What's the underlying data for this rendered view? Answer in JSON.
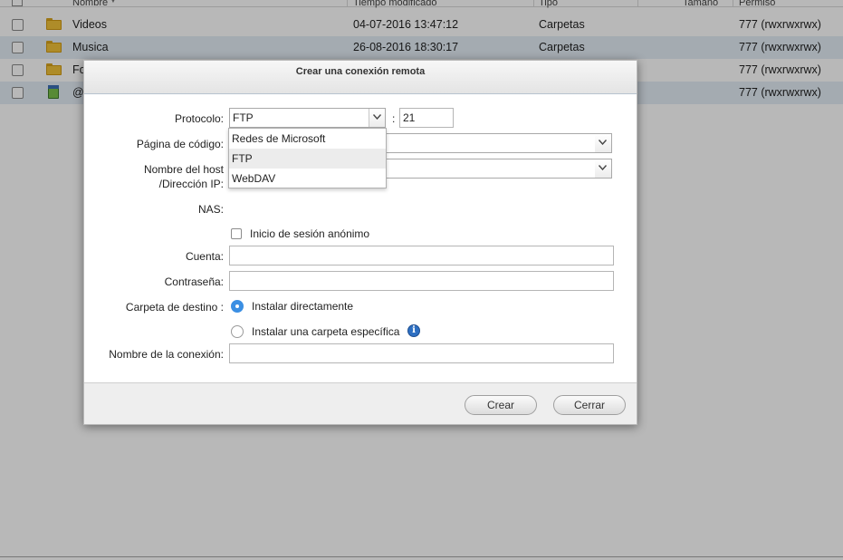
{
  "file_list": {
    "columns": {
      "name": "Nombre",
      "modified": "Tiempo modificado",
      "type": "Tipo",
      "size": "Tamaño",
      "permission": "Permiso"
    },
    "rows": [
      {
        "name": "Videos",
        "modified": "04-07-2016 13:47:12",
        "type": "Carpetas",
        "permission": "777 (rwxrwxrwx)",
        "icon": "folder-icon"
      },
      {
        "name": "Musica",
        "modified": "26-08-2016 18:30:17",
        "type": "Carpetas",
        "permission": "777 (rwxrwxrwx)",
        "icon": "folder-icon"
      },
      {
        "name": "Fo",
        "modified": "",
        "type": "",
        "permission": "777 (rwxrwxrwx)",
        "icon": "folder-icon"
      },
      {
        "name": "@",
        "modified": "",
        "type": "",
        "permission": "777 (rwxrwxrwx)",
        "icon": "recycle-bin-icon"
      }
    ]
  },
  "dialog": {
    "title": "Crear una conexión remota",
    "protocol": {
      "label": "Protocolo:",
      "value": "FTP",
      "port_separator": ":",
      "port": "21",
      "options": [
        "Redes de Microsoft",
        "FTP",
        "WebDAV"
      ],
      "selected_index": 1
    },
    "codepage": {
      "label": "Página de código:",
      "value": ""
    },
    "host": {
      "label_line1": "Nombre del host",
      "label_line2": "/Dirección IP:",
      "value": ""
    },
    "nas": {
      "label": "NAS:"
    },
    "anonymous": {
      "label": "Inicio de sesión anónimo",
      "checked": false
    },
    "account": {
      "label": "Cuenta:",
      "value": ""
    },
    "password": {
      "label": "Contraseña:",
      "value": ""
    },
    "destination": {
      "label": "Carpeta de destino :",
      "option_direct": "Instalar directamente",
      "option_specific": "Instalar una carpeta específica",
      "selected": "Instalar directamente"
    },
    "connection_name": {
      "label": "Nombre de la conexión:",
      "value": ""
    },
    "buttons": {
      "create": "Crear",
      "close": "Cerrar"
    }
  },
  "colors": {
    "accent": "#3b8fe3",
    "row_highlight": "#e3edf6",
    "folder": "#f2c23a",
    "info": "#2d6fc2"
  }
}
